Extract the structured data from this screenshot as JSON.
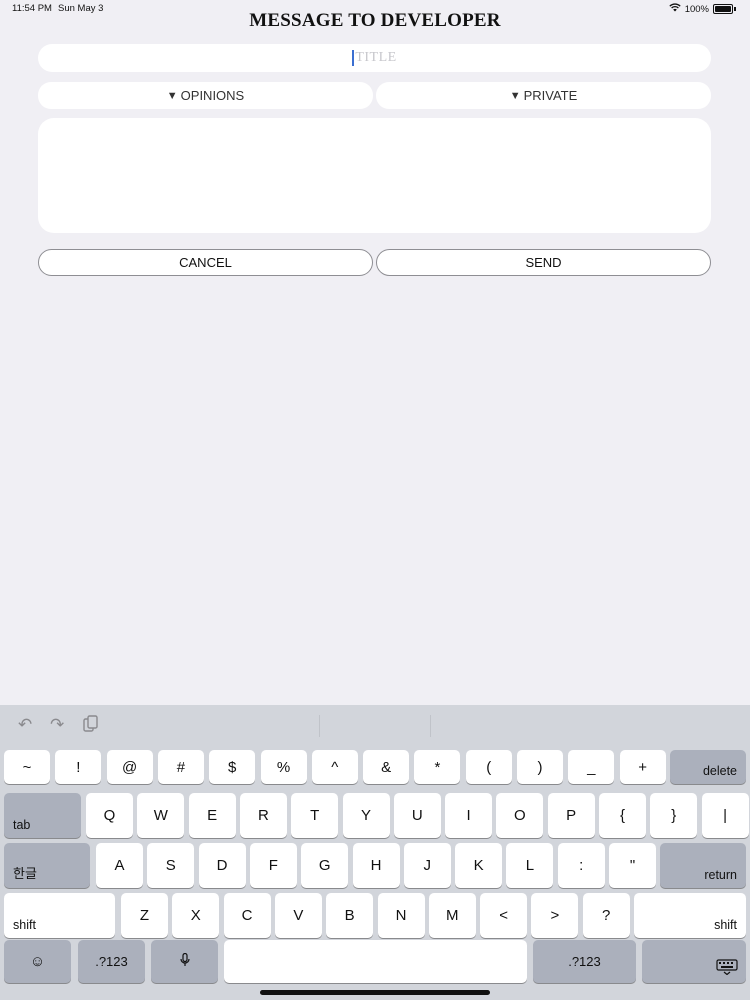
{
  "status": {
    "time": "11:54 PM",
    "date": "Sun May 3",
    "battery": "100%"
  },
  "page": {
    "title": "MESSAGE TO DEVELOPER"
  },
  "form": {
    "title_placeholder": "TITLE",
    "category": "OPINIONS",
    "privacy": "PRIVATE",
    "body_value": "",
    "cancel_label": "CANCEL",
    "send_label": "SEND"
  },
  "keyboard": {
    "toolbar": [
      "undo-icon",
      "redo-icon",
      "paste-icon"
    ],
    "row1": [
      "~",
      "!",
      "@",
      "#",
      "$",
      "%",
      "^",
      "&",
      "*",
      "(",
      ")",
      "_",
      "+"
    ],
    "delete": "delete",
    "tab": "tab",
    "row2": [
      "Q",
      "W",
      "E",
      "R",
      "T",
      "Y",
      "U",
      "I",
      "O",
      "P",
      "{",
      "}",
      "|"
    ],
    "lang": "한글",
    "row3": [
      "A",
      "S",
      "D",
      "F",
      "G",
      "H",
      "J",
      "K",
      "L",
      ":",
      "\""
    ],
    "return": "return",
    "shift": "shift",
    "row4": [
      "Z",
      "X",
      "C",
      "V",
      "B",
      "N",
      "M",
      "<",
      ">",
      "?"
    ],
    "num_label": ".?123"
  }
}
